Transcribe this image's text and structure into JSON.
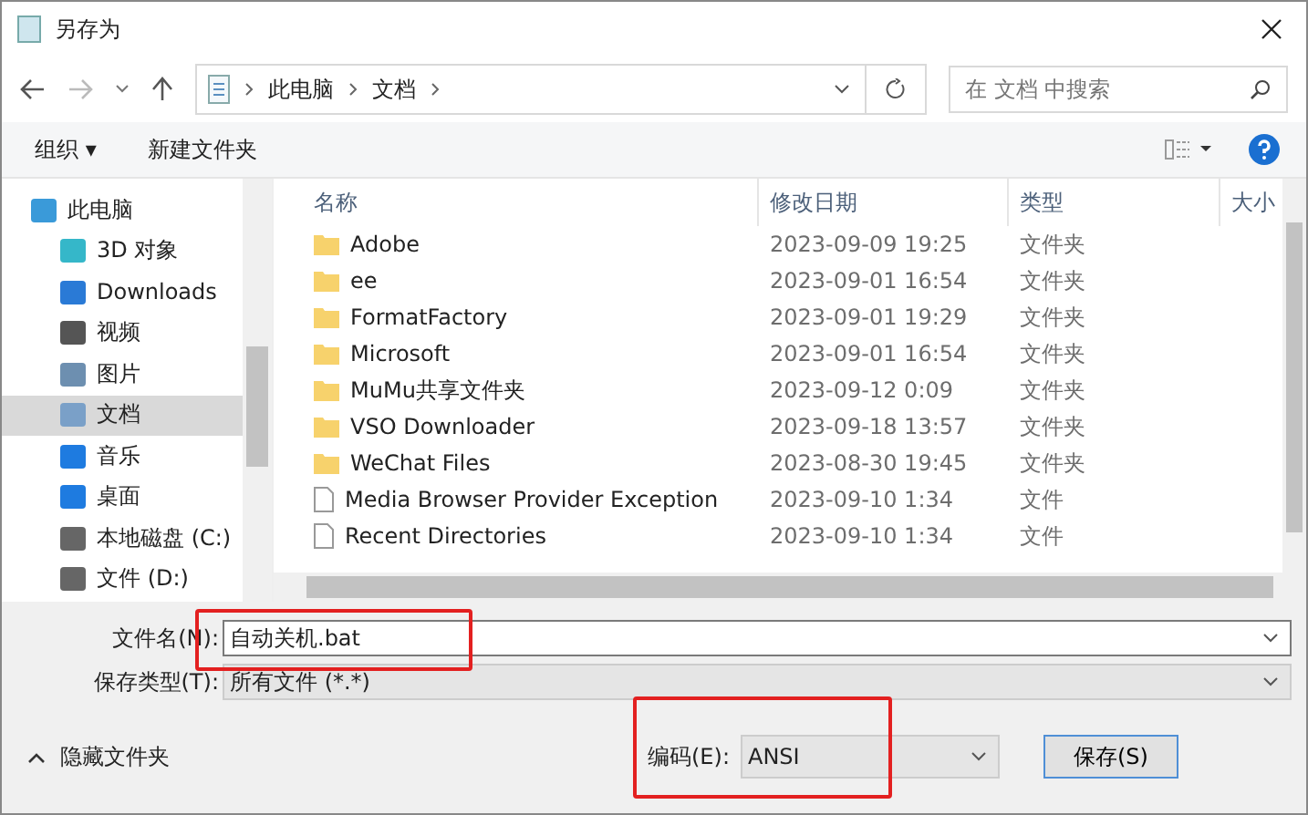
{
  "window": {
    "title": "另存为"
  },
  "breadcrumb": [
    "此电脑",
    "文档"
  ],
  "search": {
    "placeholder": "在 文档 中搜索"
  },
  "toolbar": {
    "organize": "组织 ▾",
    "new_folder": "新建文件夹"
  },
  "sidebar": {
    "items": [
      {
        "label": "此电脑",
        "selected": false,
        "children": [
          {
            "label": "3D 对象",
            "selected": false
          },
          {
            "label": "Downloads",
            "selected": false
          },
          {
            "label": "视频",
            "selected": false
          },
          {
            "label": "图片",
            "selected": false
          },
          {
            "label": "文档",
            "selected": true
          },
          {
            "label": "音乐",
            "selected": false
          },
          {
            "label": "桌面",
            "selected": false
          },
          {
            "label": "本地磁盘 (C:)",
            "selected": false
          },
          {
            "label": "文件 (D:)",
            "selected": false
          }
        ]
      }
    ]
  },
  "table": {
    "columns": [
      "名称",
      "修改日期",
      "类型",
      "大小"
    ],
    "rows": [
      {
        "kind": "folder",
        "name": "Adobe",
        "date": "2023-09-09 19:25",
        "type": "文件夹"
      },
      {
        "kind": "folder",
        "name": "ee",
        "date": "2023-09-01 16:54",
        "type": "文件夹"
      },
      {
        "kind": "folder",
        "name": "FormatFactory",
        "date": "2023-09-01 19:29",
        "type": "文件夹"
      },
      {
        "kind": "folder",
        "name": "Microsoft",
        "date": "2023-09-01 16:54",
        "type": "文件夹"
      },
      {
        "kind": "folder",
        "name": "MuMu共享文件夹",
        "date": "2023-09-12 0:09",
        "type": "文件夹"
      },
      {
        "kind": "folder",
        "name": "VSO Downloader",
        "date": "2023-09-18 13:57",
        "type": "文件夹"
      },
      {
        "kind": "folder",
        "name": "WeChat Files",
        "date": "2023-08-30 19:45",
        "type": "文件夹"
      },
      {
        "kind": "file",
        "name": "Media Browser Provider Exception",
        "date": "2023-09-10 1:34",
        "type": "文件"
      },
      {
        "kind": "file",
        "name": "Recent Directories",
        "date": "2023-09-10 1:34",
        "type": "文件"
      }
    ]
  },
  "form": {
    "filename_label": "文件名(N):",
    "filename": "自动关机.bat",
    "type_label": "保存类型(T):",
    "type": "所有文件 (*.*)",
    "encoding_label": "编码(E):",
    "encoding": "ANSI"
  },
  "hide_folders": "隐藏文件夹",
  "save_button": "保存(S)"
}
